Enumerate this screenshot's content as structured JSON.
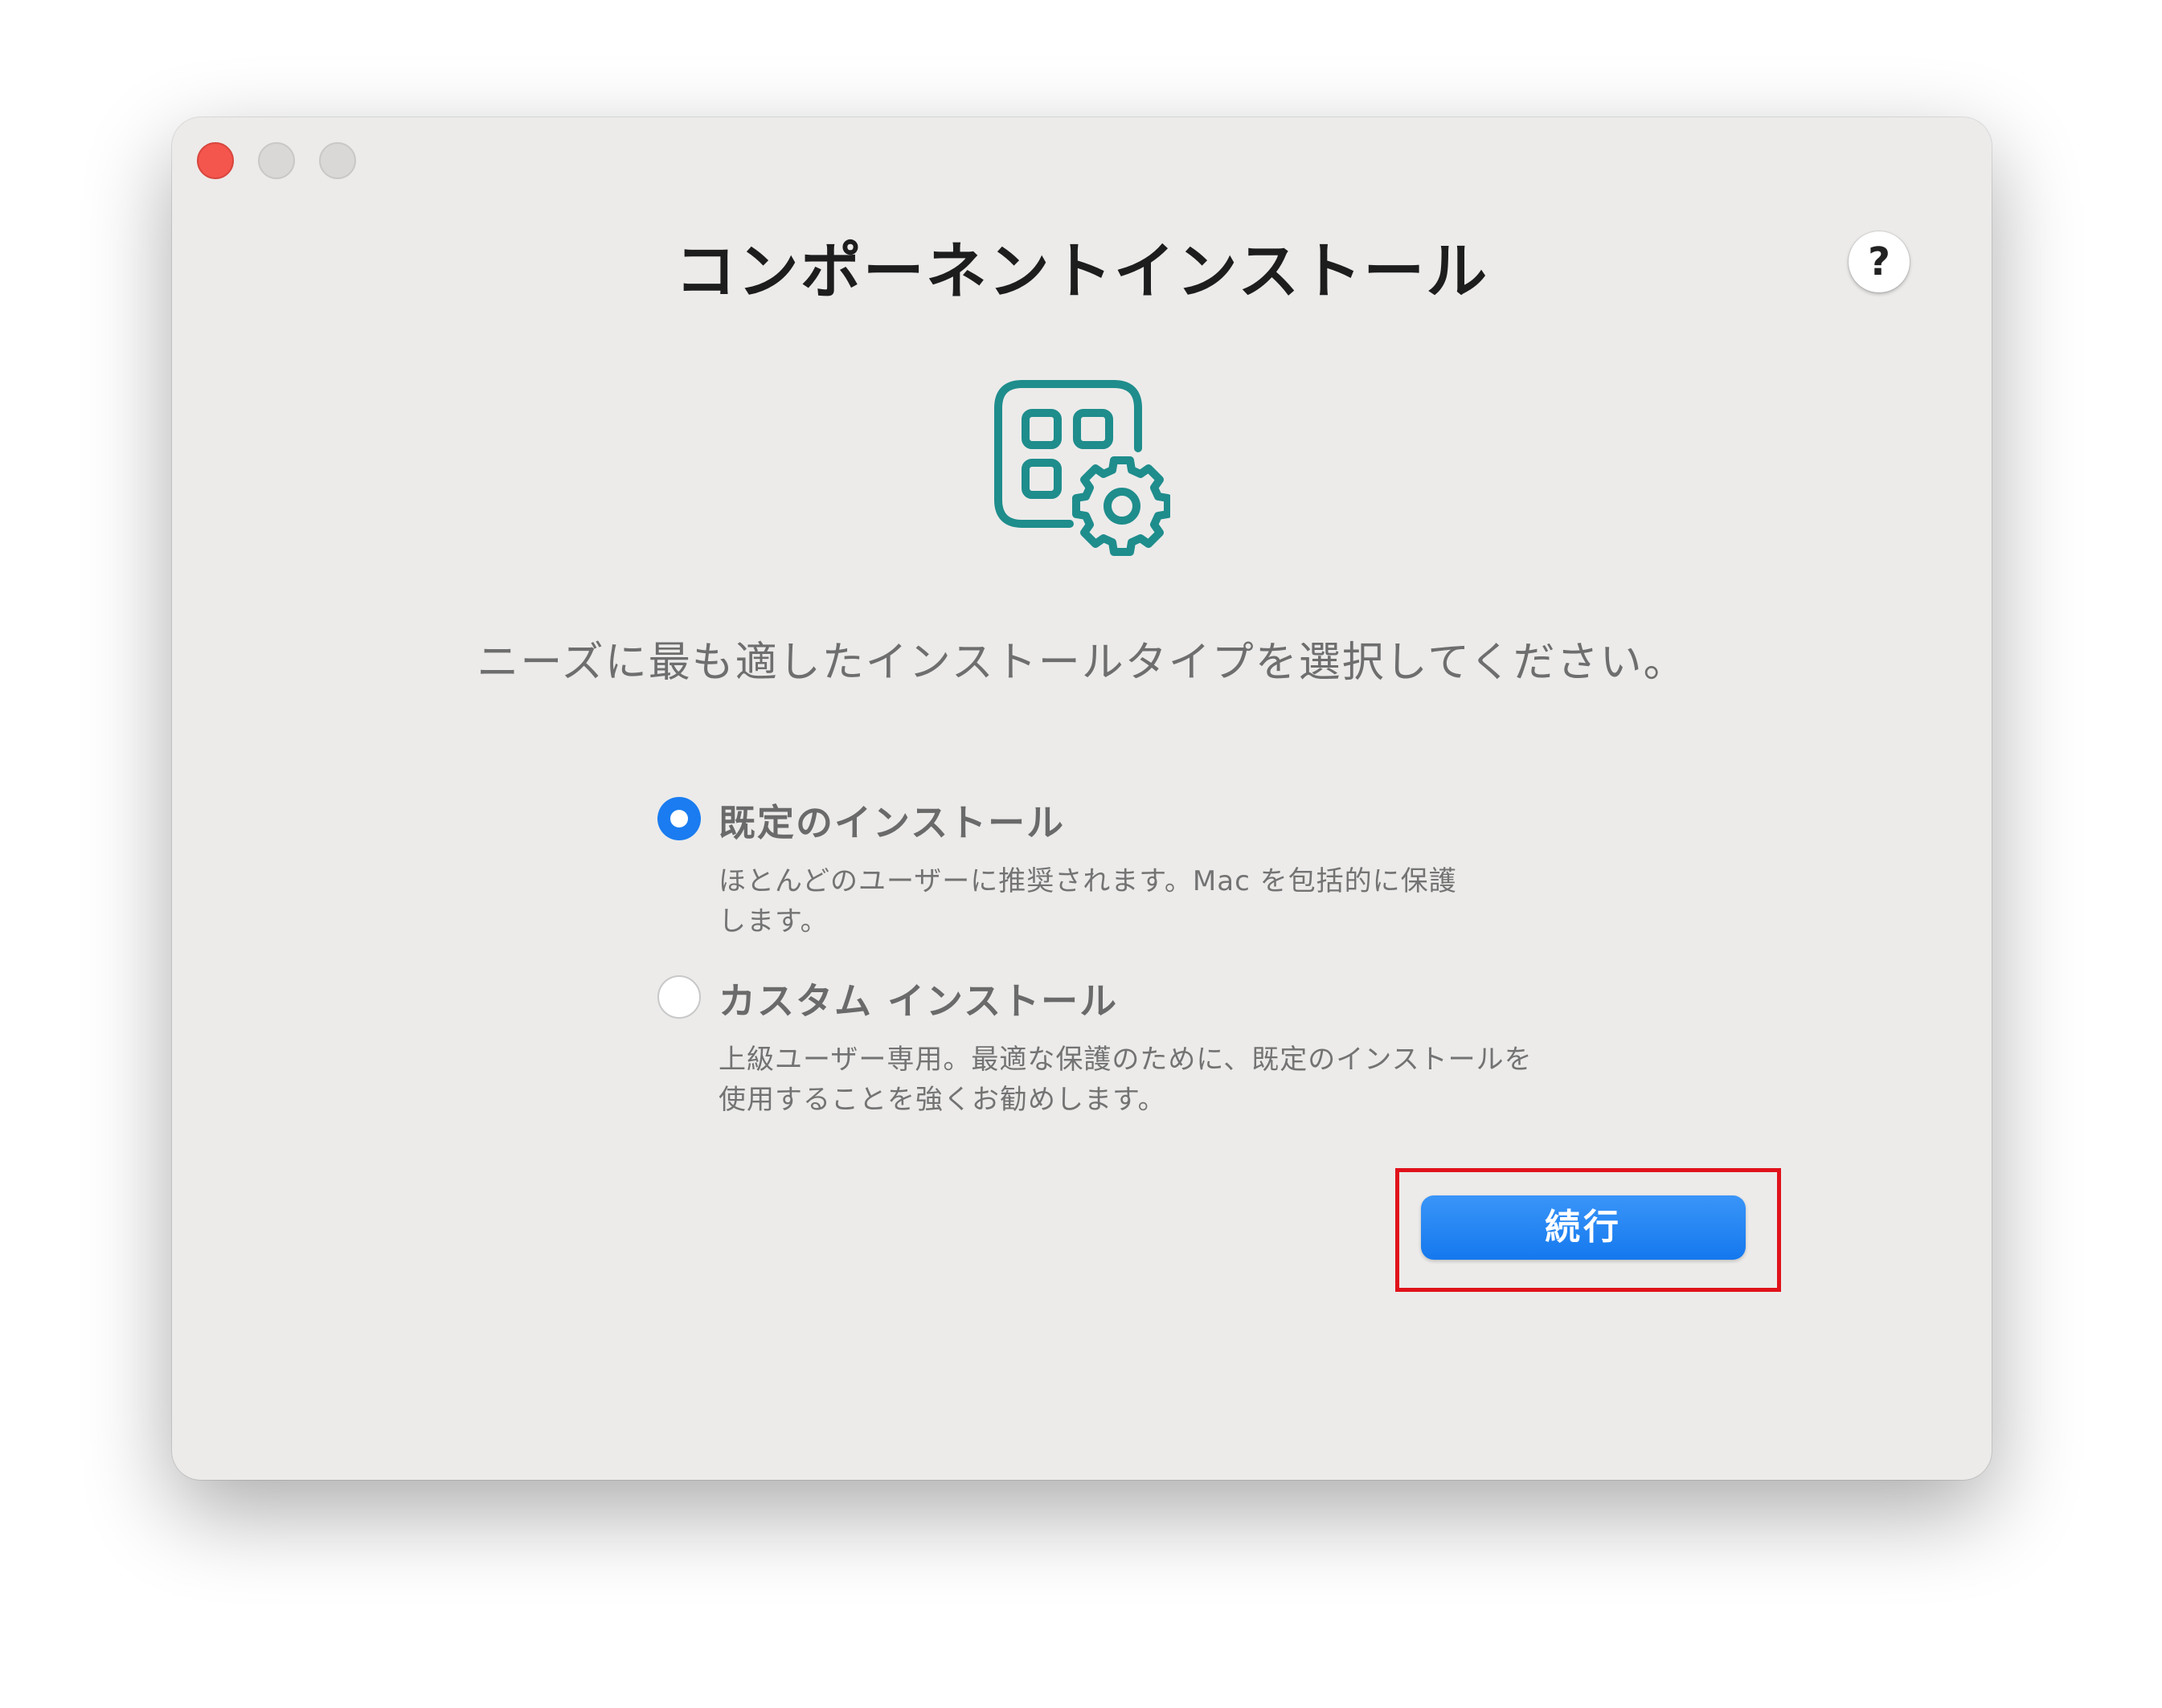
{
  "window": {
    "title": "コンポーネントインストール",
    "help_label": "?"
  },
  "icon": {
    "name": "component-settings-icon",
    "color": "#1e8d8c"
  },
  "subtitle": "ニーズに最も適したインストールタイプを選択してください。",
  "options": [
    {
      "label": "既定のインストール",
      "description_line1": "ほとんどのユーザーに推奨されます。Mac を包括的に保護",
      "description_line2": "します。",
      "selected": true
    },
    {
      "label": "カスタム インストール",
      "description_line1": "上級ユーザー専用。最適な保護のために、既定のインストールを",
      "description_line2": "使用することを強くお勧めします。",
      "selected": false
    }
  ],
  "footer": {
    "continue_label": "続行"
  },
  "colors": {
    "accent": "#1a7cf0",
    "highlight_border": "#e0121b",
    "icon_teal": "#1e8d8c"
  }
}
